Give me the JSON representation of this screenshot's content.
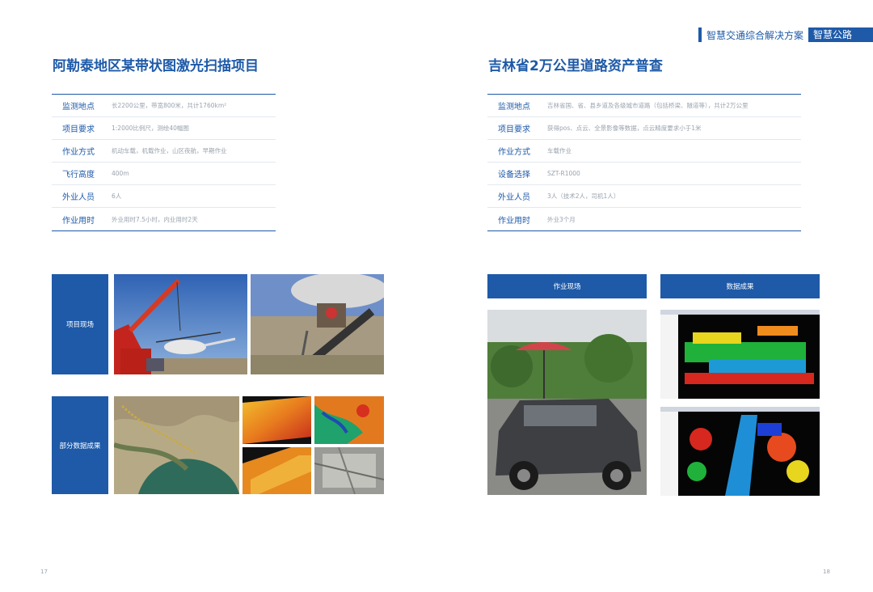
{
  "header": {
    "subtitle": "智慧交通综合解决方案",
    "tag": "智慧公路"
  },
  "left": {
    "title": "阿勒泰地区某带状图激光扫描项目",
    "rows": [
      {
        "label": "监测地点",
        "value": "长2200公里，带宽800米，共计1760km²"
      },
      {
        "label": "项目要求",
        "value": "1:2000比例尺，测绘40幅图"
      },
      {
        "label": "作业方式",
        "value": "机动车载，机载作业，山区夜航，早期作业"
      },
      {
        "label": "飞行高度",
        "value": "400m"
      },
      {
        "label": "外业人员",
        "value": "6人"
      },
      {
        "label": "作业用时",
        "value": "外业用时7.5小时，内业用时2天"
      }
    ],
    "box_site": "项目现场",
    "box_data": "部分数据成果"
  },
  "right": {
    "title": "吉林省2万公里道路资产普查",
    "rows": [
      {
        "label": "监测地点",
        "value": "吉林省国、省、县乡道及各级城市道路（包括桥梁、隧道等），共计2万公里"
      },
      {
        "label": "项目要求",
        "value": "获得pos、点云、全景影像等数据，点云精度要求小于1米"
      },
      {
        "label": "作业方式",
        "value": "车载作业"
      },
      {
        "label": "设备选择",
        "value": "SZT-R1000"
      },
      {
        "label": "外业人员",
        "value": "3人（技术2人，司机1人）"
      },
      {
        "label": "作业用时",
        "value": "外业3个月"
      }
    ],
    "box_work": "作业现场",
    "box_result": "数据成果"
  },
  "pages": {
    "left": "17",
    "right": "18"
  },
  "colors": {
    "brand": "#1e5aa8",
    "muted_text": "#9aa3ad"
  }
}
